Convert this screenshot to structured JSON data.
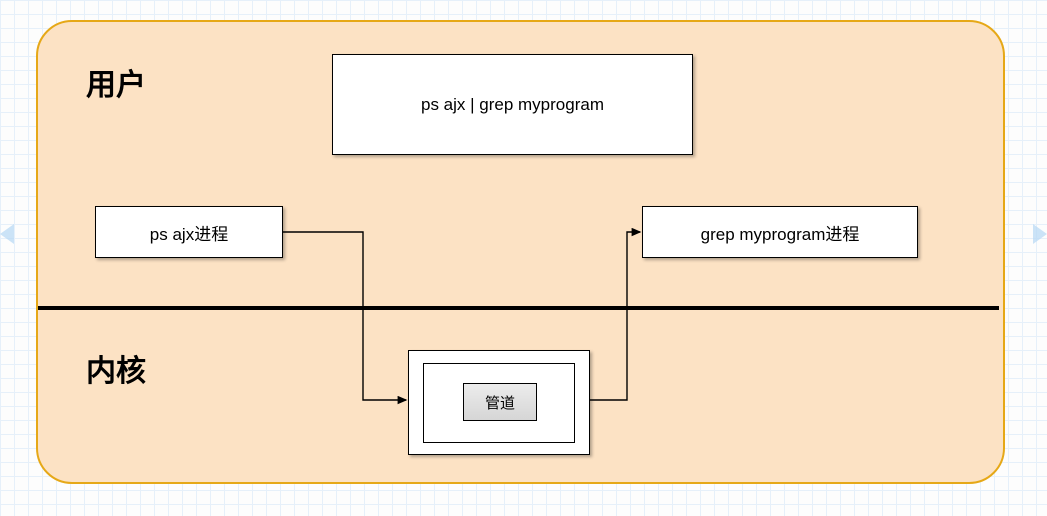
{
  "labels": {
    "user": "用户",
    "kernel": "内核"
  },
  "command_box": "ps  ajx | grep myprogram",
  "process_left": "ps  ajx进程",
  "process_right": "grep myprogram进程",
  "pipe_label": "管道"
}
